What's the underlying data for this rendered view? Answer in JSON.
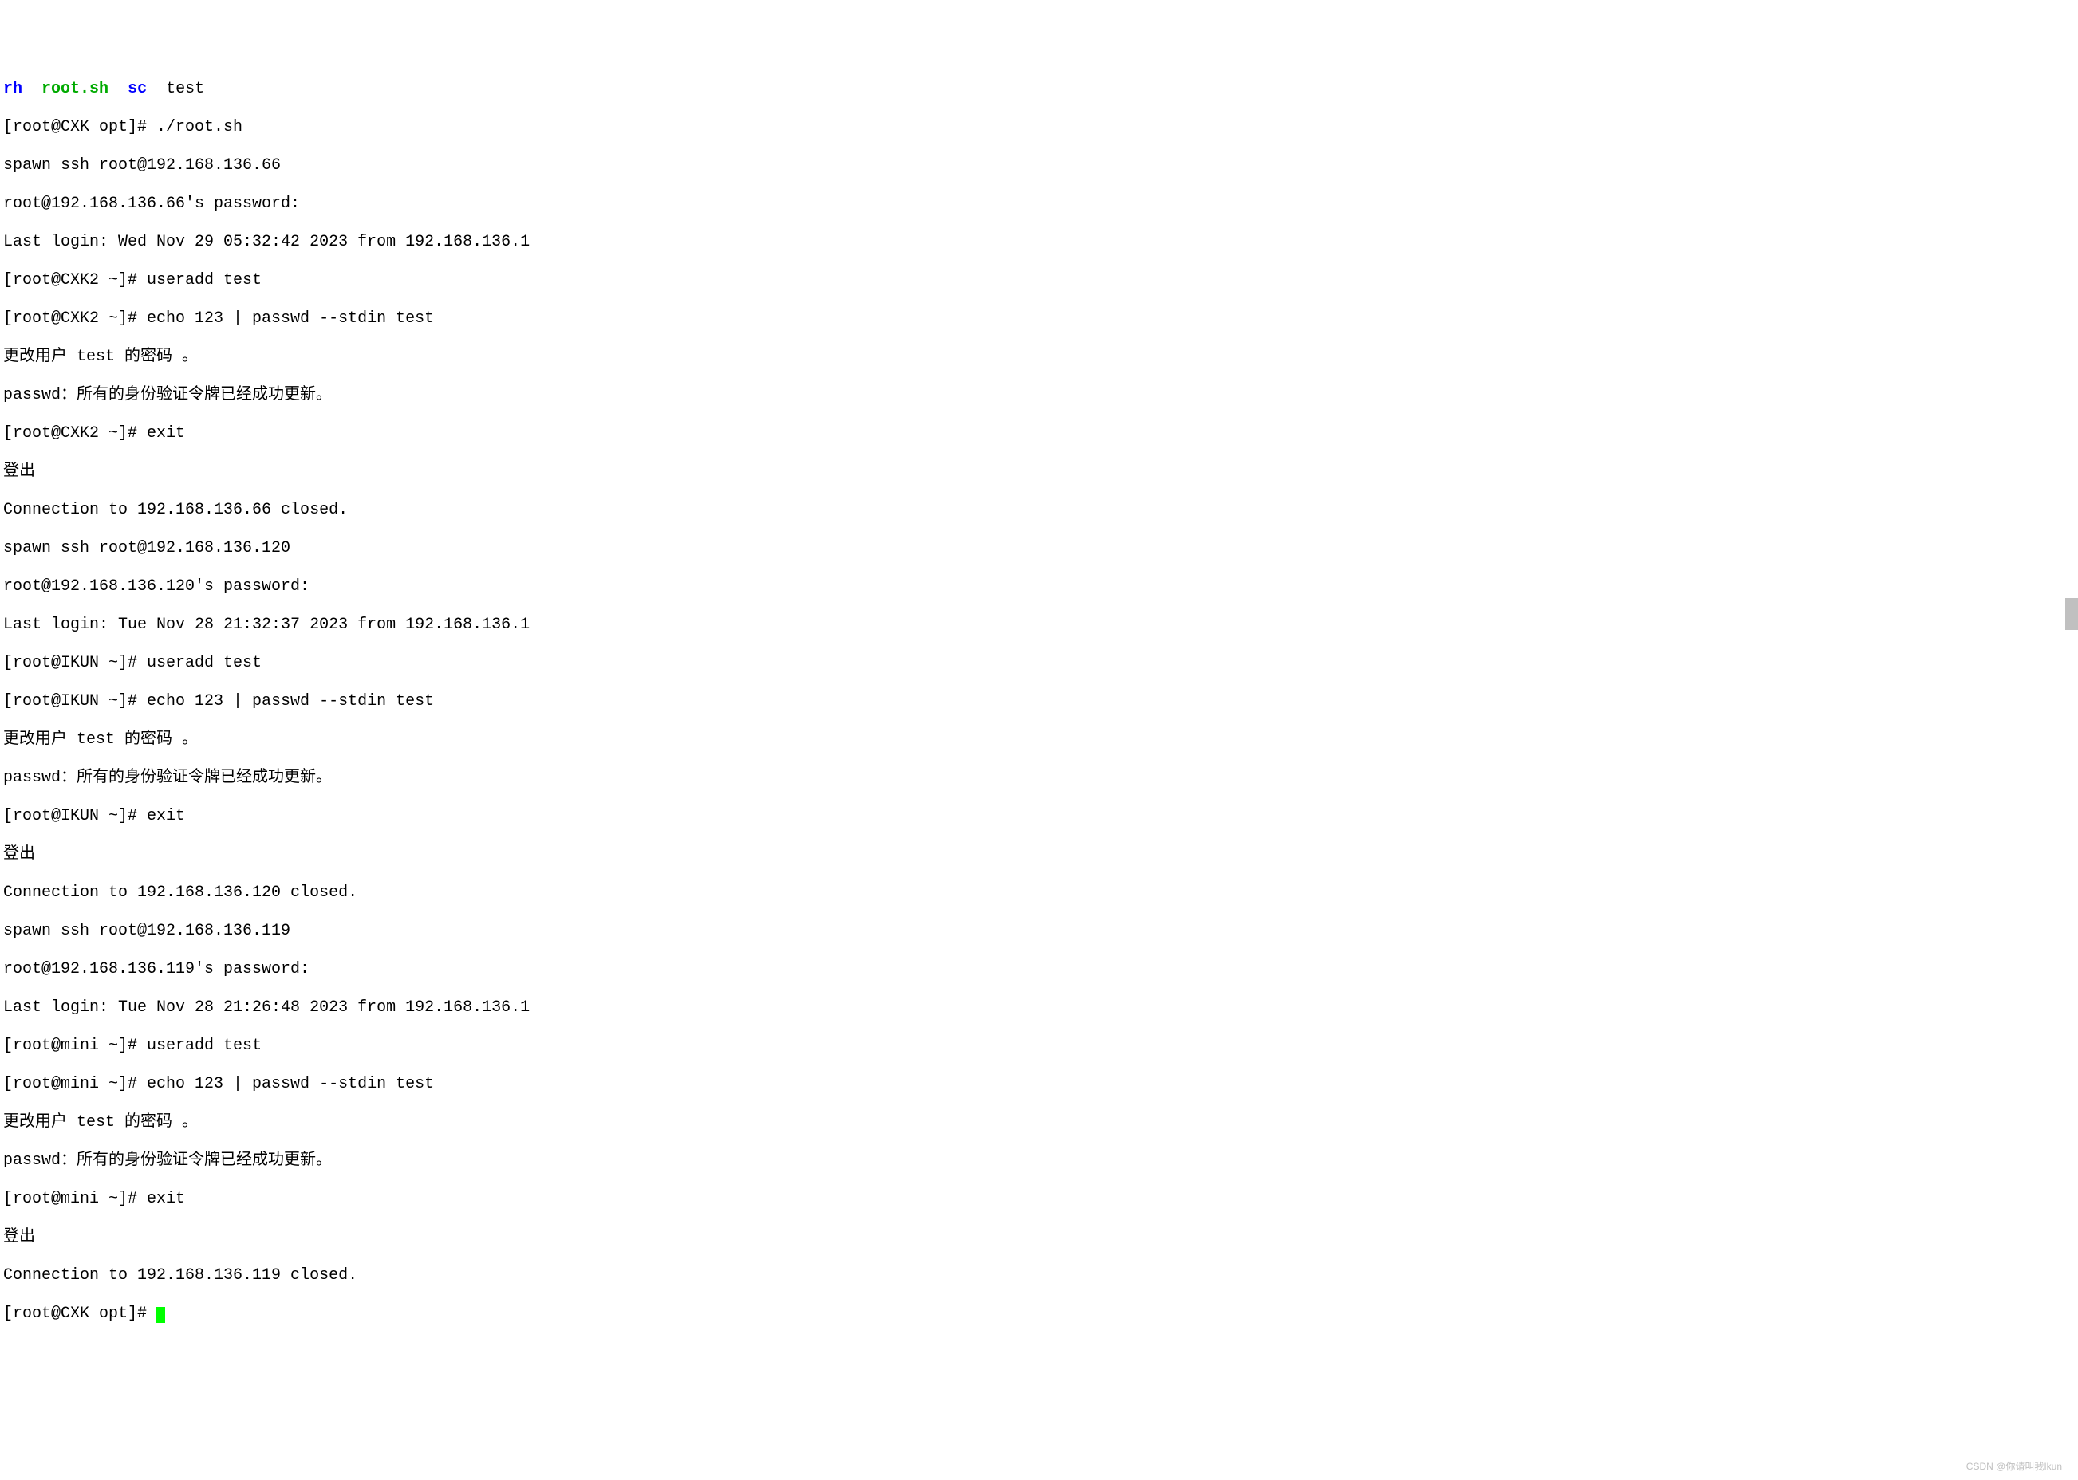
{
  "header": {
    "item1": "rh",
    "item2": "root.sh",
    "item3": "sc",
    "item4": "test"
  },
  "lines": {
    "l01": "[root@CXK opt]# ./root.sh",
    "l02": "spawn ssh root@192.168.136.66",
    "l03": "root@192.168.136.66's password:",
    "l04": "Last login: Wed Nov 29 05:32:42 2023 from 192.168.136.1",
    "l05": "[root@CXK2 ~]# useradd test",
    "l06": "[root@CXK2 ~]# echo 123 | passwd --stdin test",
    "l07": "更改用户 test 的密码 。",
    "l08": "passwd：所有的身份验证令牌已经成功更新。",
    "l09": "[root@CXK2 ~]# exit",
    "l10": "登出",
    "l11": "Connection to 192.168.136.66 closed.",
    "l12": "spawn ssh root@192.168.136.120",
    "l13": "root@192.168.136.120's password:",
    "l14": "Last login: Tue Nov 28 21:32:37 2023 from 192.168.136.1",
    "l15": "[root@IKUN ~]# useradd test",
    "l16": "[root@IKUN ~]# echo 123 | passwd --stdin test",
    "l17": "更改用户 test 的密码 。",
    "l18": "passwd：所有的身份验证令牌已经成功更新。",
    "l19": "[root@IKUN ~]# exit",
    "l20": "登出",
    "l21": "Connection to 192.168.136.120 closed.",
    "l22": "spawn ssh root@192.168.136.119",
    "l23": "root@192.168.136.119's password:",
    "l24": "Last login: Tue Nov 28 21:26:48 2023 from 192.168.136.1",
    "l25": "[root@mini ~]# useradd test",
    "l26": "[root@mini ~]# echo 123 | passwd --stdin test",
    "l27": "更改用户 test 的密码 。",
    "l28": "passwd：所有的身份验证令牌已经成功更新。",
    "l29": "[root@mini ~]# exit",
    "l30": "登出",
    "l31": "Connection to 192.168.136.119 closed.",
    "l32": "[root@CXK opt]# "
  },
  "watermark": "CSDN @你请叫我Ikun"
}
